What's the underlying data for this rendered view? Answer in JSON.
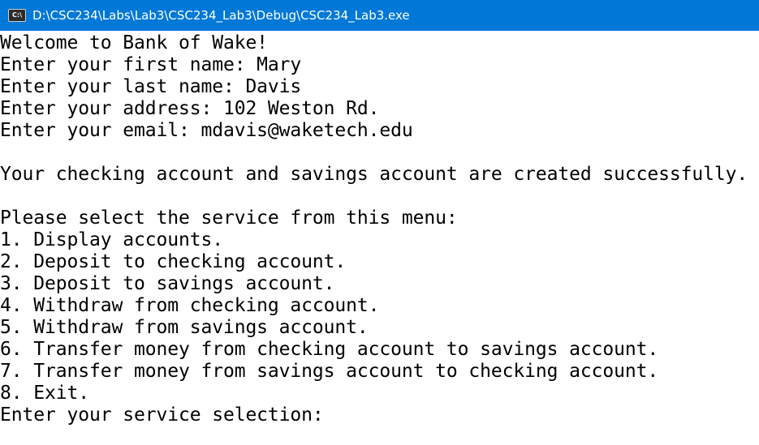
{
  "window": {
    "title": "D:\\CSC234\\Labs\\Lab3\\CSC234_Lab3\\Debug\\CSC234_Lab3.exe",
    "icon": "console-app-icon",
    "icon_glyph": "C:\\",
    "titlebar_color": "#0078d7"
  },
  "console": {
    "lines": [
      "Welcome to Bank of Wake!",
      "Enter your first name: Mary",
      "Enter your last name: Davis",
      "Enter your address: 102 Weston Rd.",
      "Enter your email: mdavis@waketech.edu",
      "",
      "Your checking account and savings account are created successfully.",
      "",
      "Please select the service from this menu:",
      "1. Display accounts.",
      "2. Deposit to checking account.",
      "3. Deposit to savings account.",
      "4. Withdraw from checking account.",
      "5. Withdraw from savings account.",
      "6. Transfer money from checking account to savings account.",
      "7. Transfer money from savings account to checking account.",
      "8. Exit.",
      "Enter your service selection:"
    ]
  }
}
